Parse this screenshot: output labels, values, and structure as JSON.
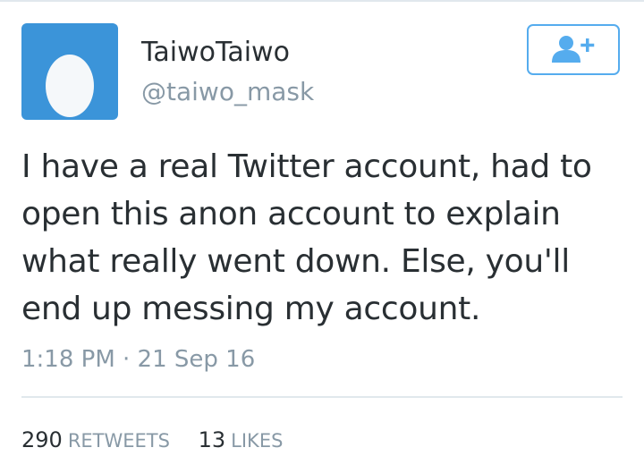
{
  "tweet": {
    "author": {
      "display_name": "TaiwoTaiwo",
      "handle": "@taiwo_mask",
      "avatar_icon": "default-egg-avatar"
    },
    "follow_button": {
      "icon": "follow-user-plus-icon"
    },
    "text": "I have a real Twitter account, had to open this anon account to explain what really went down. Else, you'll end up messing my account.",
    "timestamp": "1:18 PM · 21 Sep 16",
    "stats": {
      "retweets_count": "290",
      "retweets_label": "RETWEETS",
      "likes_count": "13",
      "likes_label": "LIKES"
    }
  },
  "colors": {
    "brand_blue": "#55acee",
    "avatar_bg": "#3b94d9",
    "text_primary": "#292f33",
    "text_secondary": "#8899a6",
    "divider": "#e1e8ed"
  }
}
